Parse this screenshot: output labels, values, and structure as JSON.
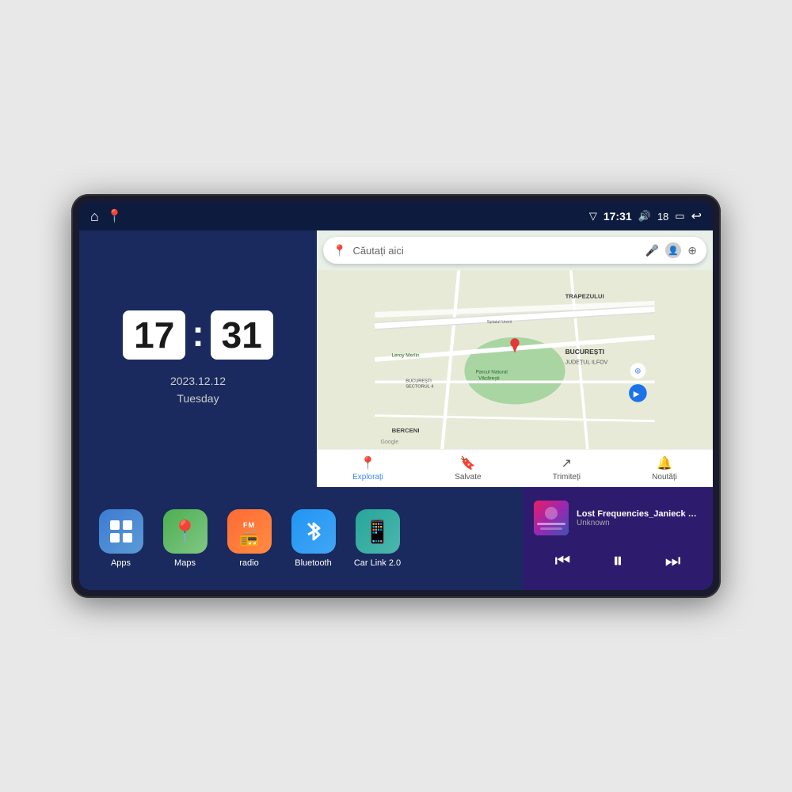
{
  "device": {
    "status_bar": {
      "time": "17:31",
      "signal": "▽",
      "volume_icon": "🔊",
      "battery_level": "18",
      "battery_icon": "🔋",
      "back_icon": "↩",
      "home_icon": "⌂",
      "maps_icon": "📍"
    },
    "clock": {
      "hours": "17",
      "minutes": "31",
      "date": "2023.12.12",
      "day": "Tuesday"
    },
    "map": {
      "search_placeholder": "Căutați aici",
      "nav_items": [
        {
          "label": "Explorați",
          "icon": "📍",
          "active": true
        },
        {
          "label": "Salvate",
          "icon": "🔖",
          "active": false
        },
        {
          "label": "Trimiteți",
          "icon": "↗",
          "active": false
        },
        {
          "label": "Noutăți",
          "icon": "🔔",
          "active": false
        }
      ],
      "labels": {
        "trapezului": "TRAPEZULUI",
        "bucuresti": "BUCUREȘTI",
        "judet_ilfov": "JUDEȚUL ILFOV",
        "berceni": "BERCENI",
        "parc": "Parcul Natural Văcărești",
        "leroy": "Leroy Merlin",
        "sector4": "BUCUREȘTI\nSECTORUL 4",
        "splai": "Splaiul Unirii"
      }
    },
    "apps": [
      {
        "id": "apps",
        "label": "Apps",
        "bg_class": "apps-bg",
        "icon": "grid"
      },
      {
        "id": "maps",
        "label": "Maps",
        "bg_class": "maps-bg",
        "icon": "📍"
      },
      {
        "id": "radio",
        "label": "radio",
        "bg_class": "radio-bg",
        "icon": "📻"
      },
      {
        "id": "bluetooth",
        "label": "Bluetooth",
        "bg_class": "bt-bg",
        "icon": "⚡"
      },
      {
        "id": "carlink",
        "label": "Car Link 2.0",
        "bg_class": "carlink-bg",
        "icon": "📱"
      }
    ],
    "music_player": {
      "title": "Lost Frequencies_Janieck Devy-...",
      "artist": "Unknown",
      "controls": {
        "prev": "⏮",
        "play_pause": "⏸",
        "next": "⏭"
      }
    }
  }
}
